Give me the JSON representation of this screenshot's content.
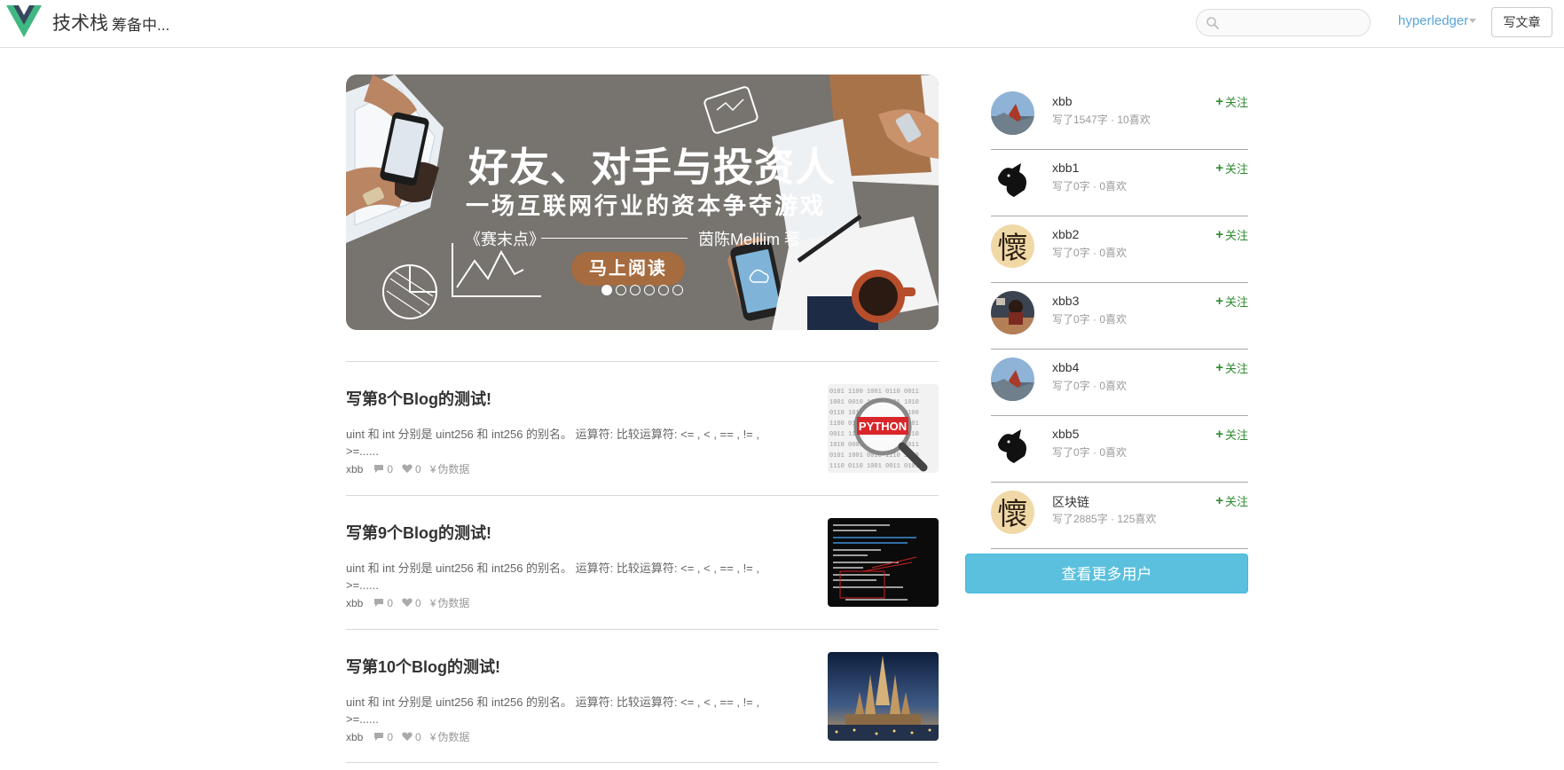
{
  "header": {
    "brand": "技术栈",
    "brand_sub": "筹备中...",
    "search_placeholder": "",
    "user_name": "hyperledger",
    "write_button": "写文章"
  },
  "banner": {
    "title": "好友、对手与投资人",
    "subtitle": "一场互联网行业的资本争夺游戏",
    "book": "《赛末点》",
    "author": "茵陈Melilim 著",
    "button": "马上阅读",
    "slide_count": 6,
    "active_slide": 1
  },
  "articles": [
    {
      "title": "写第8个Blog的测试!",
      "abstract": "uint 和 int 分别是 uint256 和 int256 的别名。 运算符: 比较运算符: <= , < , == , != , >=......",
      "author": "xbb",
      "comments": "0",
      "likes": "0",
      "reward": "伪数据",
      "thumb": "python-magnifier"
    },
    {
      "title": "写第9个Blog的测试!",
      "abstract": "uint 和 int 分别是 uint256 和 int256 的别名。 运算符: 比较运算符: <= , < , == , != , >=......",
      "author": "xbb",
      "comments": "0",
      "likes": "0",
      "reward": "伪数据",
      "thumb": "terminal"
    },
    {
      "title": "写第10个Blog的测试!",
      "abstract": "uint 和 int 分别是 uint256 和 int256 的别名。 运算符: 比较运算符: <= , < , == , != , >=......",
      "author": "xbb",
      "comments": "0",
      "likes": "0",
      "reward": "伪数据",
      "thumb": "castle"
    }
  ],
  "users": [
    {
      "name": "xbb",
      "stats": "写了1547字 · 10喜欢",
      "avatar": "landscape",
      "follow": "关注"
    },
    {
      "name": "xbb1",
      "stats": "写了0字 · 0喜欢",
      "avatar": "cat",
      "follow": "关注"
    },
    {
      "name": "xbb2",
      "stats": "写了0字 · 0喜欢",
      "avatar": "calligraphy",
      "follow": "关注"
    },
    {
      "name": "xbb3",
      "stats": "写了0字 · 0喜欢",
      "avatar": "photo-person",
      "follow": "关注"
    },
    {
      "name": "xbb4",
      "stats": "写了0字 · 0喜欢",
      "avatar": "landscape",
      "follow": "关注"
    },
    {
      "name": "xbb5",
      "stats": "写了0字 · 0喜欢",
      "avatar": "cat",
      "follow": "关注"
    },
    {
      "name": "区块链",
      "stats": "写了2885字 · 125喜欢",
      "avatar": "calligraphy",
      "follow": "关注"
    }
  ],
  "more_users_button": "查看更多用户",
  "colors": {
    "accent": "#5bc0de",
    "follow": "#2f8a2f",
    "link": "#5ba4d8",
    "logo_green": "#41b883",
    "logo_dark": "#35495e"
  }
}
